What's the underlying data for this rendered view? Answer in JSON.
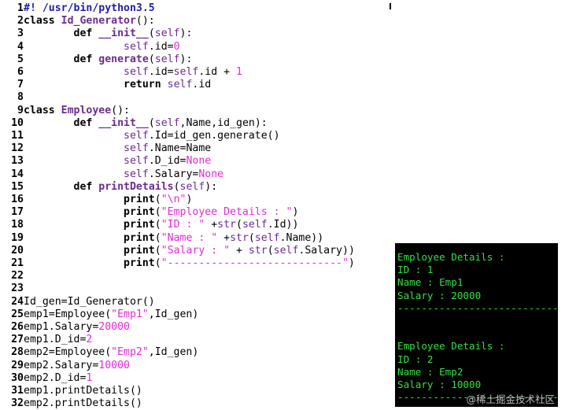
{
  "editor": {
    "lines": [
      {
        "n": "1",
        "tokens": [
          {
            "t": "#! /usr/bin/python3.5",
            "c": "shebang"
          }
        ]
      },
      {
        "n": "2",
        "tokens": [
          {
            "t": "class ",
            "c": "kw"
          },
          {
            "t": "Id_Generator",
            "c": "def"
          },
          {
            "t": "():",
            "c": "plain"
          }
        ]
      },
      {
        "n": "3",
        "tokens": [
          {
            "t": "        ",
            "c": "plain"
          },
          {
            "t": "def ",
            "c": "kw"
          },
          {
            "t": "__init__",
            "c": "def"
          },
          {
            "t": "(",
            "c": "plain"
          },
          {
            "t": "self",
            "c": "self"
          },
          {
            "t": "):",
            "c": "plain"
          }
        ]
      },
      {
        "n": "4",
        "tokens": [
          {
            "t": "                ",
            "c": "plain"
          },
          {
            "t": "self",
            "c": "self"
          },
          {
            "t": ".id=",
            "c": "plain"
          },
          {
            "t": "0",
            "c": "num"
          }
        ]
      },
      {
        "n": "5",
        "tokens": [
          {
            "t": "        ",
            "c": "plain"
          },
          {
            "t": "def ",
            "c": "kw"
          },
          {
            "t": "generate",
            "c": "def"
          },
          {
            "t": "(",
            "c": "plain"
          },
          {
            "t": "self",
            "c": "self"
          },
          {
            "t": "):",
            "c": "plain"
          }
        ]
      },
      {
        "n": "6",
        "tokens": [
          {
            "t": "                ",
            "c": "plain"
          },
          {
            "t": "self",
            "c": "self"
          },
          {
            "t": ".id=",
            "c": "plain"
          },
          {
            "t": "self",
            "c": "self"
          },
          {
            "t": ".id + ",
            "c": "plain"
          },
          {
            "t": "1",
            "c": "num"
          }
        ]
      },
      {
        "n": "7",
        "tokens": [
          {
            "t": "                ",
            "c": "plain"
          },
          {
            "t": "return ",
            "c": "kw"
          },
          {
            "t": "self",
            "c": "self"
          },
          {
            "t": ".id",
            "c": "plain"
          }
        ]
      },
      {
        "n": "8",
        "tokens": []
      },
      {
        "n": "9",
        "tokens": [
          {
            "t": "class ",
            "c": "kw"
          },
          {
            "t": "Employee",
            "c": "def"
          },
          {
            "t": "():",
            "c": "plain"
          }
        ]
      },
      {
        "n": "10",
        "tokens": [
          {
            "t": "        ",
            "c": "plain"
          },
          {
            "t": "def ",
            "c": "kw"
          },
          {
            "t": "__init__",
            "c": "def"
          },
          {
            "t": "(",
            "c": "plain"
          },
          {
            "t": "self",
            "c": "self"
          },
          {
            "t": ",Name,id_gen):",
            "c": "plain"
          }
        ]
      },
      {
        "n": "11",
        "tokens": [
          {
            "t": "                ",
            "c": "plain"
          },
          {
            "t": "self",
            "c": "self"
          },
          {
            "t": ".Id=id_gen.generate()",
            "c": "plain"
          }
        ]
      },
      {
        "n": "12",
        "tokens": [
          {
            "t": "                ",
            "c": "plain"
          },
          {
            "t": "self",
            "c": "self"
          },
          {
            "t": ".Name=Name",
            "c": "plain"
          }
        ]
      },
      {
        "n": "13",
        "tokens": [
          {
            "t": "                ",
            "c": "plain"
          },
          {
            "t": "self",
            "c": "self"
          },
          {
            "t": ".D_id=",
            "c": "plain"
          },
          {
            "t": "None",
            "c": "const"
          }
        ]
      },
      {
        "n": "14",
        "tokens": [
          {
            "t": "                ",
            "c": "plain"
          },
          {
            "t": "self",
            "c": "self"
          },
          {
            "t": ".Salary=",
            "c": "plain"
          },
          {
            "t": "None",
            "c": "const"
          }
        ]
      },
      {
        "n": "15",
        "tokens": [
          {
            "t": "        ",
            "c": "plain"
          },
          {
            "t": "def ",
            "c": "kw"
          },
          {
            "t": "printDetails",
            "c": "def"
          },
          {
            "t": "(",
            "c": "plain"
          },
          {
            "t": "self",
            "c": "self"
          },
          {
            "t": "):",
            "c": "plain"
          }
        ]
      },
      {
        "n": "16",
        "tokens": [
          {
            "t": "                ",
            "c": "plain"
          },
          {
            "t": "print",
            "c": "kw"
          },
          {
            "t": "(",
            "c": "plain"
          },
          {
            "t": "\"\\n\"",
            "c": "str"
          },
          {
            "t": ")",
            "c": "plain"
          }
        ]
      },
      {
        "n": "17",
        "tokens": [
          {
            "t": "                ",
            "c": "plain"
          },
          {
            "t": "print",
            "c": "kw"
          },
          {
            "t": "(",
            "c": "plain"
          },
          {
            "t": "\"Employee Details : \"",
            "c": "str"
          },
          {
            "t": ")",
            "c": "plain"
          }
        ]
      },
      {
        "n": "18",
        "tokens": [
          {
            "t": "                ",
            "c": "plain"
          },
          {
            "t": "print",
            "c": "kw"
          },
          {
            "t": "(",
            "c": "plain"
          },
          {
            "t": "\"ID : \"",
            "c": "str"
          },
          {
            "t": " +",
            "c": "plain"
          },
          {
            "t": "str",
            "c": "self"
          },
          {
            "t": "(",
            "c": "plain"
          },
          {
            "t": "self",
            "c": "self"
          },
          {
            "t": ".Id))",
            "c": "plain"
          }
        ]
      },
      {
        "n": "19",
        "tokens": [
          {
            "t": "                ",
            "c": "plain"
          },
          {
            "t": "print",
            "c": "kw"
          },
          {
            "t": "(",
            "c": "plain"
          },
          {
            "t": "\"Name : \"",
            "c": "str"
          },
          {
            "t": " +",
            "c": "plain"
          },
          {
            "t": "str",
            "c": "self"
          },
          {
            "t": "(",
            "c": "plain"
          },
          {
            "t": "self",
            "c": "self"
          },
          {
            "t": ".Name))",
            "c": "plain"
          }
        ]
      },
      {
        "n": "20",
        "tokens": [
          {
            "t": "                ",
            "c": "plain"
          },
          {
            "t": "print",
            "c": "kw"
          },
          {
            "t": "(",
            "c": "plain"
          },
          {
            "t": "\"Salary : \"",
            "c": "str"
          },
          {
            "t": " + ",
            "c": "plain"
          },
          {
            "t": "str",
            "c": "self"
          },
          {
            "t": "(",
            "c": "plain"
          },
          {
            "t": "self",
            "c": "self"
          },
          {
            "t": ".Salary))",
            "c": "plain"
          }
        ]
      },
      {
        "n": "21",
        "tokens": [
          {
            "t": "                ",
            "c": "plain"
          },
          {
            "t": "print",
            "c": "kw"
          },
          {
            "t": "(",
            "c": "plain"
          },
          {
            "t": "\"----------------------------\"",
            "c": "str"
          },
          {
            "t": ")",
            "c": "plain"
          }
        ]
      },
      {
        "n": "22",
        "tokens": []
      },
      {
        "n": "23",
        "tokens": []
      },
      {
        "n": "24",
        "tokens": [
          {
            "t": "Id_gen=Id_Generator()",
            "c": "plain"
          }
        ]
      },
      {
        "n": "25",
        "tokens": [
          {
            "t": "emp1=Employee(",
            "c": "plain"
          },
          {
            "t": "\"Emp1\"",
            "c": "str"
          },
          {
            "t": ",Id_gen)",
            "c": "plain"
          }
        ]
      },
      {
        "n": "26",
        "tokens": [
          {
            "t": "emp1.Salary=",
            "c": "plain"
          },
          {
            "t": "20000",
            "c": "num"
          }
        ]
      },
      {
        "n": "27",
        "tokens": [
          {
            "t": "emp1.D_id=",
            "c": "plain"
          },
          {
            "t": "2",
            "c": "num"
          }
        ]
      },
      {
        "n": "28",
        "tokens": [
          {
            "t": "emp2=Employee(",
            "c": "plain"
          },
          {
            "t": "\"Emp2\"",
            "c": "str"
          },
          {
            "t": ",Id_gen)",
            "c": "plain"
          }
        ]
      },
      {
        "n": "29",
        "tokens": [
          {
            "t": "emp2.Salary=",
            "c": "plain"
          },
          {
            "t": "10000",
            "c": "num"
          }
        ]
      },
      {
        "n": "30",
        "tokens": [
          {
            "t": "emp2.D_id=",
            "c": "plain"
          },
          {
            "t": "1",
            "c": "num"
          }
        ]
      },
      {
        "n": "31",
        "tokens": [
          {
            "t": "emp1.printDetails()",
            "c": "plain"
          }
        ]
      },
      {
        "n": "32",
        "tokens": [
          {
            "t": "emp2.printDetails()",
            "c": "plain"
          }
        ]
      }
    ]
  },
  "terminal": {
    "lines": [
      "Employee Details :",
      "ID : 1",
      "Name : Emp1",
      "Salary : 20000",
      "------------------------------",
      "",
      "",
      "Employee Details :",
      "ID : 2",
      "Name : Emp2",
      "Salary : 10000",
      "------------------------------"
    ],
    "watermark": "@稀土掘金技术社区"
  },
  "colors": {
    "terminal_bg": "#000000",
    "terminal_text": "#36e03c",
    "keyword_def": "#6b2d8f",
    "string_number": "#e22bd8",
    "shebang": "#1f1fa8"
  }
}
